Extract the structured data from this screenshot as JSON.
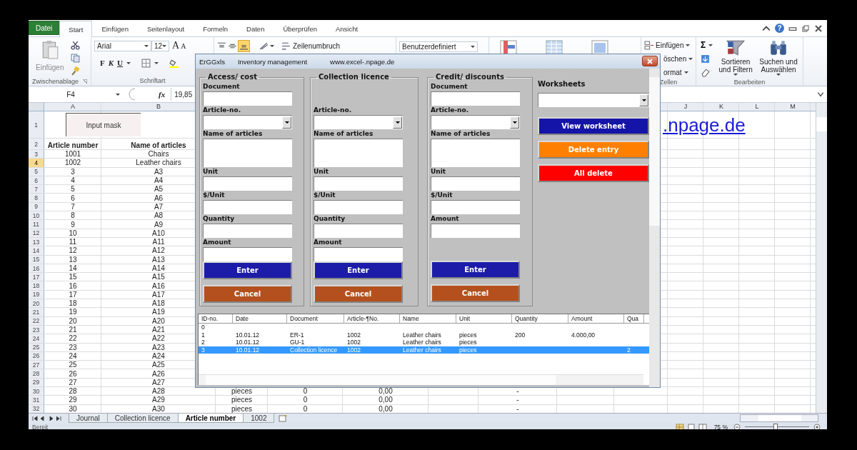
{
  "ribbon_tabs": [
    {
      "label": "Datei",
      "kind": "file",
      "selected": false
    },
    {
      "label": "Start",
      "kind": "tab",
      "selected": true
    },
    {
      "label": "Einfügen",
      "kind": "tab",
      "selected": false
    },
    {
      "label": "Seitenlayout",
      "kind": "tab",
      "selected": false
    },
    {
      "label": "Formeln",
      "kind": "tab",
      "selected": false
    },
    {
      "label": "Daten",
      "kind": "tab",
      "selected": false
    },
    {
      "label": "Überprüfen",
      "kind": "tab",
      "selected": false
    },
    {
      "label": "Ansicht",
      "kind": "tab",
      "selected": false
    }
  ],
  "window_controls": {
    "help": "?"
  },
  "ribbon": {
    "clipboard": {
      "paste": "Einfügen",
      "paste_disabled": true,
      "group": "Zwischenablage"
    },
    "font": {
      "family": "Arial",
      "size": "12",
      "grow": "A",
      "shrink": "A",
      "bold": "F",
      "italic": "K",
      "underline": "U",
      "group": "Schriftart"
    },
    "alignment": {
      "wrap": "Zeilenumbruch"
    },
    "number": {
      "format": "Benutzerdefiniert"
    },
    "cells": {
      "insert": "Einfügen",
      "delete": "öschen",
      "format": "ormat",
      "group": "Zellen"
    },
    "editing": {
      "sum": "Σ",
      "sort": "Sortieren und Filtern",
      "find": "Suchen und Auswählen",
      "group": "Bearbeiten"
    }
  },
  "formula_bar": {
    "name_box": "F4",
    "fx": "fx",
    "value": "19,85"
  },
  "sheet": {
    "columns": [
      "A",
      "B",
      "J",
      "K",
      "L",
      "M"
    ],
    "input_mask": "Input mask",
    "link": ".npage.de",
    "rows": [
      {
        "n": "1",
        "kind": "title",
        "selected": false
      },
      {
        "n": "2",
        "kind": "header",
        "selected": false,
        "cells": {
          "A": "Article number",
          "B": "Name of articles"
        }
      },
      {
        "n": "3",
        "kind": "data",
        "selected": false,
        "cells": {
          "A": "1001",
          "B": "Chairs"
        }
      },
      {
        "n": "4",
        "kind": "data",
        "selected": true,
        "cells": {
          "A": "1002",
          "B": "Leather chairs"
        }
      },
      {
        "n": "5",
        "kind": "data",
        "selected": false,
        "cells": {
          "A": "3",
          "B": "A3"
        }
      },
      {
        "n": "6",
        "kind": "data",
        "selected": false,
        "cells": {
          "A": "4",
          "B": "A4"
        }
      },
      {
        "n": "7",
        "kind": "data",
        "selected": false,
        "cells": {
          "A": "5",
          "B": "A5"
        }
      },
      {
        "n": "8",
        "kind": "data",
        "selected": false,
        "cells": {
          "A": "6",
          "B": "A6"
        }
      },
      {
        "n": "9",
        "kind": "data",
        "selected": false,
        "cells": {
          "A": "7",
          "B": "A7"
        }
      },
      {
        "n": "10",
        "kind": "data",
        "selected": false,
        "cells": {
          "A": "8",
          "B": "A8"
        }
      },
      {
        "n": "11",
        "kind": "data",
        "selected": false,
        "cells": {
          "A": "9",
          "B": "A9"
        }
      },
      {
        "n": "12",
        "kind": "data",
        "selected": false,
        "cells": {
          "A": "10",
          "B": "A10"
        }
      },
      {
        "n": "13",
        "kind": "data",
        "selected": false,
        "cells": {
          "A": "11",
          "B": "A11"
        }
      },
      {
        "n": "14",
        "kind": "data",
        "selected": false,
        "cells": {
          "A": "12",
          "B": "A12"
        }
      },
      {
        "n": "15",
        "kind": "data",
        "selected": false,
        "cells": {
          "A": "13",
          "B": "A13"
        }
      },
      {
        "n": "16",
        "kind": "data",
        "selected": false,
        "cells": {
          "A": "14",
          "B": "A14"
        }
      },
      {
        "n": "17",
        "kind": "data",
        "selected": false,
        "cells": {
          "A": "15",
          "B": "A15"
        }
      },
      {
        "n": "18",
        "kind": "data",
        "selected": false,
        "cells": {
          "A": "16",
          "B": "A16"
        }
      },
      {
        "n": "19",
        "kind": "data",
        "selected": false,
        "cells": {
          "A": "17",
          "B": "A17"
        }
      },
      {
        "n": "20",
        "kind": "data",
        "selected": false,
        "cells": {
          "A": "18",
          "B": "A18"
        }
      },
      {
        "n": "21",
        "kind": "data",
        "selected": false,
        "cells": {
          "A": "19",
          "B": "A19"
        }
      },
      {
        "n": "22",
        "kind": "data",
        "selected": false,
        "cells": {
          "A": "20",
          "B": "A20"
        }
      },
      {
        "n": "23",
        "kind": "data",
        "selected": false,
        "cells": {
          "A": "21",
          "B": "A21"
        }
      },
      {
        "n": "24",
        "kind": "data",
        "selected": false,
        "cells": {
          "A": "22",
          "B": "A22"
        }
      },
      {
        "n": "25",
        "kind": "data",
        "selected": false,
        "cells": {
          "A": "23",
          "B": "A23"
        }
      },
      {
        "n": "26",
        "kind": "data",
        "selected": false,
        "cells": {
          "A": "24",
          "B": "A24"
        }
      },
      {
        "n": "27",
        "kind": "data",
        "selected": false,
        "cells": {
          "A": "25",
          "B": "A25"
        }
      },
      {
        "n": "28",
        "kind": "data",
        "selected": false,
        "cells": {
          "A": "26",
          "B": "A26"
        }
      },
      {
        "n": "29",
        "kind": "data",
        "selected": false,
        "cells": {
          "A": "27",
          "B": "A27"
        }
      },
      {
        "n": "30",
        "kind": "data",
        "selected": false,
        "cells": {
          "A": "28",
          "B": "A28",
          "column_3": "pieces",
          "column_4": "0",
          "column_5": "0,00",
          "column_7": "-"
        }
      },
      {
        "n": "31",
        "kind": "data",
        "selected": false,
        "cells": {
          "A": "29",
          "B": "A29",
          "column_3": "pieces",
          "column_4": "0",
          "column_5": "0,00",
          "column_7": "-"
        }
      },
      {
        "n": "32",
        "kind": "data",
        "selected": false,
        "cells": {
          "A": "30",
          "B": "A30",
          "column_3": "pieces",
          "column_4": "0",
          "column_5": "0,00",
          "column_7": "-"
        }
      }
    ]
  },
  "sheet_tabs": [
    {
      "label": "Journal",
      "selected": false
    },
    {
      "label": "Collection licence",
      "selected": false
    },
    {
      "label": "Article number",
      "selected": true
    },
    {
      "label": "1002",
      "selected": false
    }
  ],
  "status_bar": {
    "status": "Bereit",
    "zoom": "75 %",
    "zoom_slider": {
      "level": 0.48
    }
  },
  "dialog": {
    "title": "ErGGxls",
    "subtitle": "Inventory management",
    "url": "www.excel-.npage.de",
    "frames": [
      {
        "title": "Access/ cost",
        "fields": [
          {
            "label": "Document",
            "kind": "text"
          },
          {
            "label": "Article-no.",
            "kind": "combo"
          },
          {
            "label": "Name of articles",
            "kind": "area"
          },
          {
            "label": "Unit",
            "kind": "text"
          },
          {
            "label": "$/Unit",
            "kind": "text"
          },
          {
            "label": "Quantity",
            "kind": "text"
          },
          {
            "label": "Amount",
            "kind": "text"
          }
        ],
        "buttons": [
          {
            "label": "Enter",
            "color": "#1c1ca8"
          },
          {
            "label": "Cancel",
            "color": "#b4501e"
          }
        ]
      },
      {
        "title": "Collection licence",
        "fields": [
          {
            "label": "Article-no.",
            "kind": "combo"
          },
          {
            "label": "Name of articles",
            "kind": "area"
          },
          {
            "label": "Unit",
            "kind": "text"
          },
          {
            "label": "$/Unit",
            "kind": "text"
          },
          {
            "label": "Quantity",
            "kind": "text"
          },
          {
            "label": "Amount",
            "kind": "text"
          }
        ],
        "buttons": [
          {
            "label": "Enter",
            "color": "#1c1ca8"
          },
          {
            "label": "Cancel",
            "color": "#b4501e"
          }
        ]
      },
      {
        "title": "Credit/ discounts",
        "fields": [
          {
            "label": "Document",
            "kind": "text"
          },
          {
            "label": "Article-no.",
            "kind": "combo"
          },
          {
            "label": "Name of articles",
            "kind": "area"
          },
          {
            "label": "Unit",
            "kind": "text"
          },
          {
            "label": "$/Unit",
            "kind": "text"
          },
          {
            "label": "Amount",
            "kind": "text"
          }
        ],
        "buttons": [
          {
            "label": "Enter",
            "color": "#1c1ca8"
          },
          {
            "label": "Cancel",
            "color": "#b4501e"
          }
        ]
      }
    ],
    "worksheets": {
      "label": "Worksheets",
      "buttons": [
        {
          "label": "View worksheet",
          "color": "#1414a8"
        },
        {
          "label": "Delete entry",
          "color": "#ff8000"
        },
        {
          "label": "All delete",
          "color": "#ff0000"
        }
      ]
    },
    "list": {
      "columns": [
        "ID-no.",
        "Date",
        "Document",
        "Article-¶No.",
        "Name",
        "Unit",
        "Quantity",
        "Amount",
        "Qua"
      ],
      "rows": [
        {
          "selected": false,
          "cells": [
            "0"
          ]
        },
        {
          "selected": false,
          "cells": [
            "1",
            "10.01.12",
            "ER-1",
            "1002",
            "Leather chairs",
            "pieces",
            "200",
            "4.000,00"
          ]
        },
        {
          "selected": false,
          "cells": [
            "2",
            "10.01.12",
            "GU-1",
            "1002",
            "Leather chairs",
            "pieces"
          ]
        },
        {
          "selected": true,
          "cells": [
            "3",
            "10.01.12",
            "Collection licence",
            "1002",
            "Leather chairs",
            "pieces",
            null,
            null,
            "2"
          ]
        }
      ]
    }
  }
}
